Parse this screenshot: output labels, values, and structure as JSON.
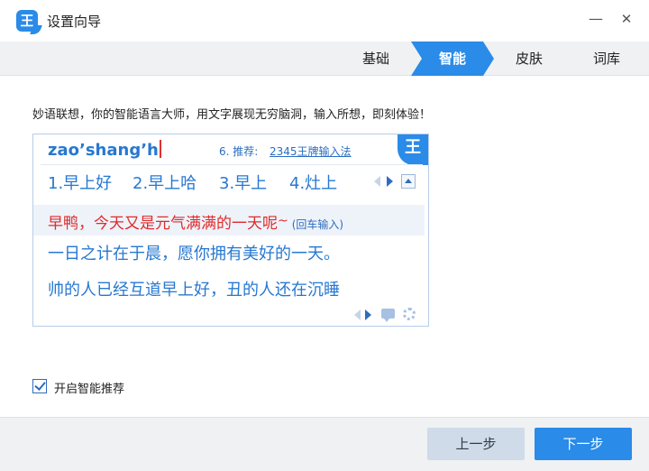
{
  "window": {
    "logo_char": "王",
    "title": "设置向导",
    "minimize_glyph": "—",
    "close_glyph": "✕"
  },
  "tabs": [
    {
      "label": "基础",
      "active": false
    },
    {
      "label": "智能",
      "active": true
    },
    {
      "label": "皮肤",
      "active": false
    },
    {
      "label": "词库",
      "active": false
    }
  ],
  "intro": "妙语联想，你的智能语言大师，用文字展现无穷脑洞，输入所想，即刻体验！",
  "demo": {
    "pinyin": "zao’shang’h",
    "recommend_label": "6. 推荐:",
    "recommend_link": "2345王牌输入法",
    "logo_char": "王",
    "candidates": [
      "1.早上好",
      "2.早上哈",
      "3.早上",
      "4.灶上"
    ],
    "smart_sentence": "早鸭，今天又是元气满满的一天呢",
    "smart_tilde": "~",
    "smart_hint": "(回车输入)",
    "sentences": [
      "一日之计在于晨，愿你拥有美好的一天。",
      "帅的人已经互道早上好，丑的人还在沉睡"
    ]
  },
  "option": {
    "label": "开启智能推荐",
    "checked": true
  },
  "footer": {
    "prev_label": "上一步",
    "next_label": "下一步"
  },
  "colors": {
    "accent": "#2a8be8",
    "candidate_text": "#2778d0",
    "smart_text": "#e02b2b"
  }
}
